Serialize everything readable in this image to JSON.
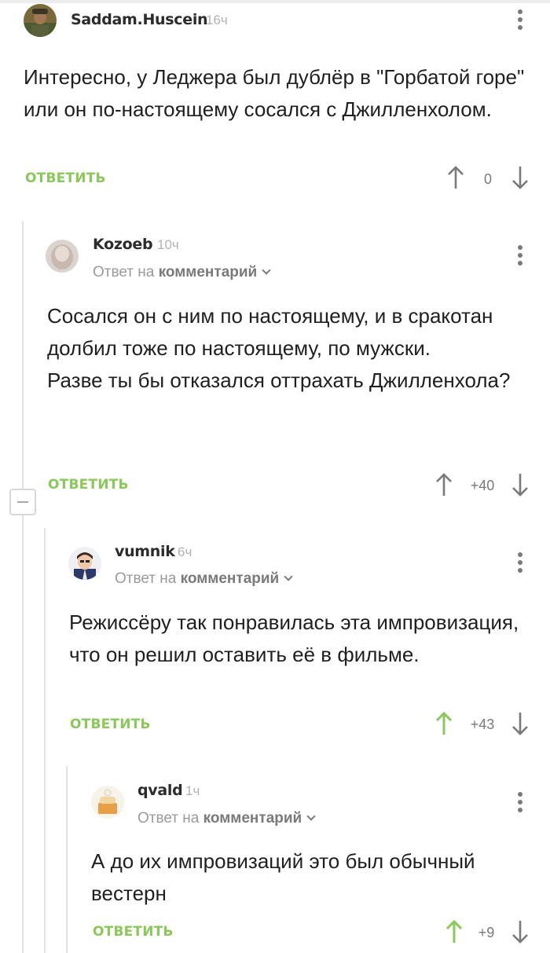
{
  "comments": [
    {
      "username": "Saddam.Huscein",
      "time": "16ч",
      "text": "Интересно, у Леджера был дублёр в \"Горбатой горе\" или он по-настоящему сосался с Джилленхолом.",
      "reply_label": "ОТВЕТИТЬ",
      "score": "0"
    },
    {
      "username": "Kozoeb",
      "time": "10ч",
      "reply_prefix": "Ответ на",
      "reply_target": "комментарий",
      "text_line1": "Сосался он с ним по настоящему, и в сракотан долбил тоже по настоящему, по мужски.",
      "text_line2": "Разве ты бы отказался оттрахать Джилленхола?",
      "reply_label": "ОТВЕТИТЬ",
      "score": "+40"
    },
    {
      "username": "vumnik",
      "time": "6ч",
      "reply_prefix": "Ответ на",
      "reply_target": "комментарий",
      "text": "Режиссёру так понравилась эта импровизация, что он решил оставить её в фильме.",
      "reply_label": "ОТВЕТИТЬ",
      "score": "+43"
    },
    {
      "username": "qvald",
      "time": "1ч",
      "reply_prefix": "Ответ на",
      "reply_target": "комментарий",
      "text": "А до их импровизаций это был обычный вестерн",
      "reply_label": "ОТВЕТИТЬ",
      "score": "+9"
    }
  ],
  "colors": {
    "accent_green": "#8ac858",
    "upvoted_green": "#8ac858",
    "neutral_gray": "#7a7a7a"
  },
  "icons": [
    "kebab-menu-icon",
    "arrow-up-icon",
    "arrow-down-icon",
    "chevron-down-icon",
    "collapse-minus-icon"
  ]
}
